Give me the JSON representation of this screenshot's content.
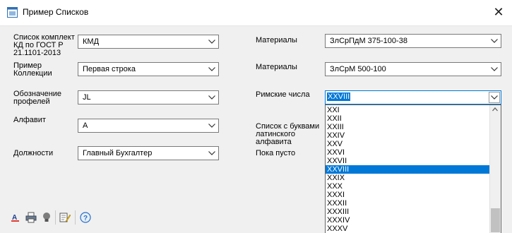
{
  "window": {
    "title": "Пример Списков",
    "close_glyph": "✕"
  },
  "fields": {
    "kit_label": "Список комплект КД по ГОСТ  Р 21.1101-2013",
    "kit_value": "КМД",
    "collection_label": "Пример\nКоллекции",
    "collection_value": "Первая строка",
    "profiles_label": "Обозначение\nпрофелей",
    "profiles_value": "JL",
    "alphabet_label": "Алфавит",
    "alphabet_value": "А",
    "positions_label": "Должности",
    "positions_value": "Главный Бухгалтер",
    "materials1_label": "Материалы",
    "materials1_value": "ЗлСрПдМ 375-100-38",
    "materials2_label": "Материалы",
    "materials2_value": "ЗлСрМ 500-100",
    "roman_label": "Римские числа",
    "roman_value": "XXVIII",
    "latin_label": "Список с буквами\nлатинского\nалфавита",
    "empty_label": "Пока пусто"
  },
  "dropdown": {
    "items": [
      "XXI",
      "XXII",
      "XXIII",
      "XXIV",
      "XXV",
      "XXVI",
      "XXVII",
      "XXVIII",
      "XXIX",
      "XXX",
      "XXXI",
      "XXXII",
      "XXXIII",
      "XXXIV",
      "XXXV"
    ],
    "selected_index": 7
  },
  "icons": {
    "app": "app-window-icon",
    "close": "close-icon",
    "chevron": "chevron-down-icon",
    "toolbar": [
      "text-color-icon",
      "printer-icon",
      "lightbulb-icon",
      "edit-notes-icon",
      "help-icon"
    ]
  },
  "colors": {
    "accent": "#0078d7",
    "background": "#f0f0f0"
  }
}
